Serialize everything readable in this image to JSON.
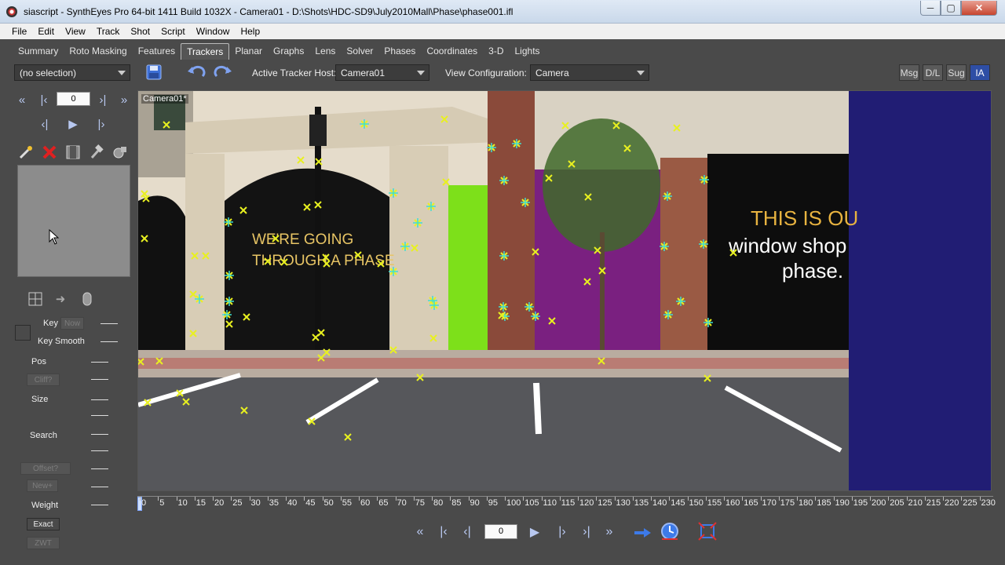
{
  "window": {
    "title": "siascript - SynthEyes Pro 64-bit 1411 Build 1032X - Camera01 - D:\\Shots\\HDC-SD9\\July2010Mall\\Phase\\phase001.ifl",
    "minimize": "─",
    "maximize": "▢",
    "close": "✕"
  },
  "menu": [
    "File",
    "Edit",
    "View",
    "Track",
    "Shot",
    "Script",
    "Window",
    "Help"
  ],
  "tabs": [
    "Summary",
    "Roto Masking",
    "Features",
    "Trackers",
    "Planar",
    "Graphs",
    "Lens",
    "Solver",
    "Phases",
    "Coordinates",
    "3-D",
    "Lights"
  ],
  "active_tab": "Trackers",
  "toolbar": {
    "selection": "(no selection)",
    "active_tracker_host_label": "Active Tracker Host:",
    "active_tracker_host": "Camera01",
    "view_configuration_label": "View Configuration:",
    "view_configuration": "Camera",
    "right_buttons": [
      "Msg",
      "D/L",
      "Sug",
      "IA"
    ]
  },
  "left_panel": {
    "frame": "0",
    "key_label": "Key",
    "now_button": "Now",
    "key_smooth_label": "Key Smooth",
    "pos_label": "Pos",
    "cliff_button": "Cliff?",
    "size_label": "Size",
    "search_label": "Search",
    "offset_button": "Offset?",
    "new_button": "New+",
    "weight_label": "Weight",
    "exact_button": "Exact",
    "zwt_button": "ZWT"
  },
  "viewport": {
    "label": "Camera01*",
    "sign_left_1": "WE'RE GOING",
    "sign_left_2": "THROUGH A PHASE",
    "sign_right_1": "THIS IS OU",
    "sign_right_2": "window shop",
    "sign_right_3": "phase."
  },
  "timeline": {
    "ticks": [
      "0",
      "5",
      "10",
      "15",
      "20",
      "25",
      "30",
      "35",
      "40",
      "45",
      "50",
      "55",
      "60",
      "65",
      "70",
      "75",
      "80",
      "85",
      "90",
      "95",
      "100",
      "105",
      "110",
      "115",
      "120",
      "125",
      "130",
      "135",
      "140",
      "145",
      "150",
      "155",
      "160",
      "165",
      "170",
      "175",
      "180",
      "185",
      "190",
      "195",
      "200",
      "205",
      "210",
      "215",
      "220",
      "225",
      "230"
    ]
  },
  "playback": {
    "frame": "0"
  },
  "icons": {
    "save": "save-icon",
    "undo": "undo-icon",
    "redo": "redo-icon"
  },
  "colors": {
    "tracker_yellow": "#e8f020",
    "tracker_cyan": "#40e0d0",
    "viewport_bg": "#211d74",
    "panel_bg": "#4a4a4a"
  }
}
